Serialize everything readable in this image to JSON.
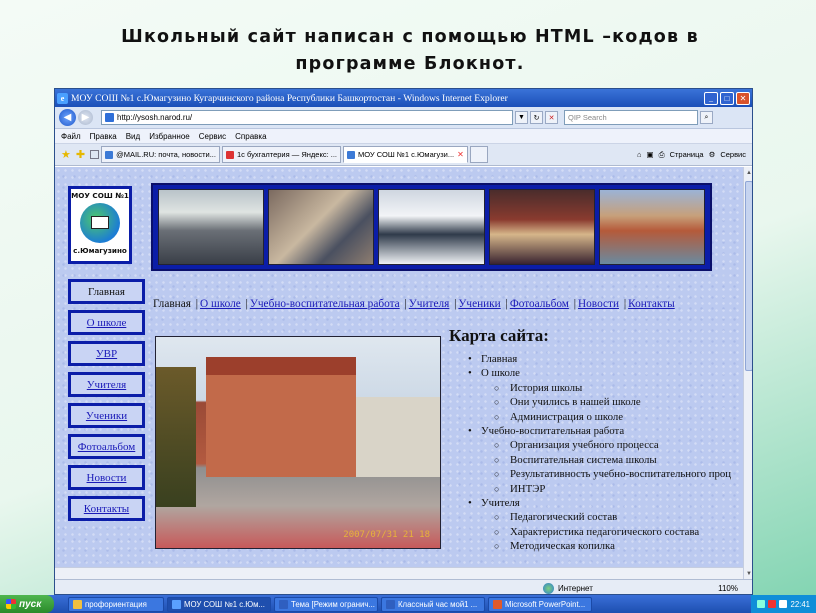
{
  "slide": {
    "heading_line1": "Школьный сайт написан с помощью HTML –кодов в",
    "heading_line2": "программе Блокнот."
  },
  "browser": {
    "window_title": "МОУ СОШ №1 с.Юмагузино Кугарчинского района Республики Башкортостан - Windows Internet Explorer",
    "address": "http://ysosh.narod.ru/",
    "search_placeholder": "QIP Search",
    "menu": [
      "Файл",
      "Правка",
      "Вид",
      "Избранное",
      "Сервис",
      "Справка"
    ],
    "tabs": [
      {
        "label": "@MAIL.RU: почта, новости..."
      },
      {
        "label": "1с бухгалтерия — Яндекс: ..."
      },
      {
        "label": "МОУ СОШ №1 с.Юмагузи...",
        "active": true
      }
    ],
    "tools": {
      "page": "Страница",
      "service": "Сервис"
    },
    "status": {
      "zone": "Интернет",
      "zoom": "110%"
    }
  },
  "site": {
    "logo": {
      "top": "МОУ СОШ №1",
      "bottom": "с.Юмагузино"
    },
    "side_nav": [
      "Главная",
      "О школе",
      "УВР",
      "Учителя",
      "Ученики",
      "Фотоальбом",
      "Новости",
      "Контакты"
    ],
    "top_nav": {
      "current": "Главная",
      "links": [
        "О школе",
        "Учебно-воспитательная работа",
        "Учителя",
        "Ученики",
        "Фотоальбом",
        "Новости",
        "Контакты"
      ]
    },
    "photo_stamp": "2007/07/31 21 18",
    "sitemap": {
      "title": "Карта сайта:",
      "items": [
        {
          "level": 1,
          "text": "Главная"
        },
        {
          "level": 1,
          "text": "О школе"
        },
        {
          "level": 2,
          "text": "История школы"
        },
        {
          "level": 2,
          "text": "Они учились в нашей школе"
        },
        {
          "level": 2,
          "text": "Администрация о школе"
        },
        {
          "level": 1,
          "text": "Учебно-воспитательная работа"
        },
        {
          "level": 2,
          "text": "Организация учебного процесса"
        },
        {
          "level": 2,
          "text": "Воспитательная система школы"
        },
        {
          "level": 2,
          "text": "Результативность учебно-воспитательного проц"
        },
        {
          "level": 2,
          "text": "ИНТЭР"
        },
        {
          "level": 1,
          "text": "Учителя"
        },
        {
          "level": 2,
          "text": "Педагогический состав"
        },
        {
          "level": 2,
          "text": "Характеристика педагогического состава"
        },
        {
          "level": 2,
          "text": "Методическая копилка"
        }
      ]
    }
  },
  "taskbar": {
    "start": "пуск",
    "items": [
      {
        "label": "профориентация"
      },
      {
        "label": "МОУ СОШ №1 с.Юм...",
        "active": true
      },
      {
        "label": "Тема [Режим огранич..."
      },
      {
        "label": "Классный час мой1 ..."
      },
      {
        "label": "Microsoft PowerPoint..."
      }
    ],
    "clock": "22:41"
  }
}
